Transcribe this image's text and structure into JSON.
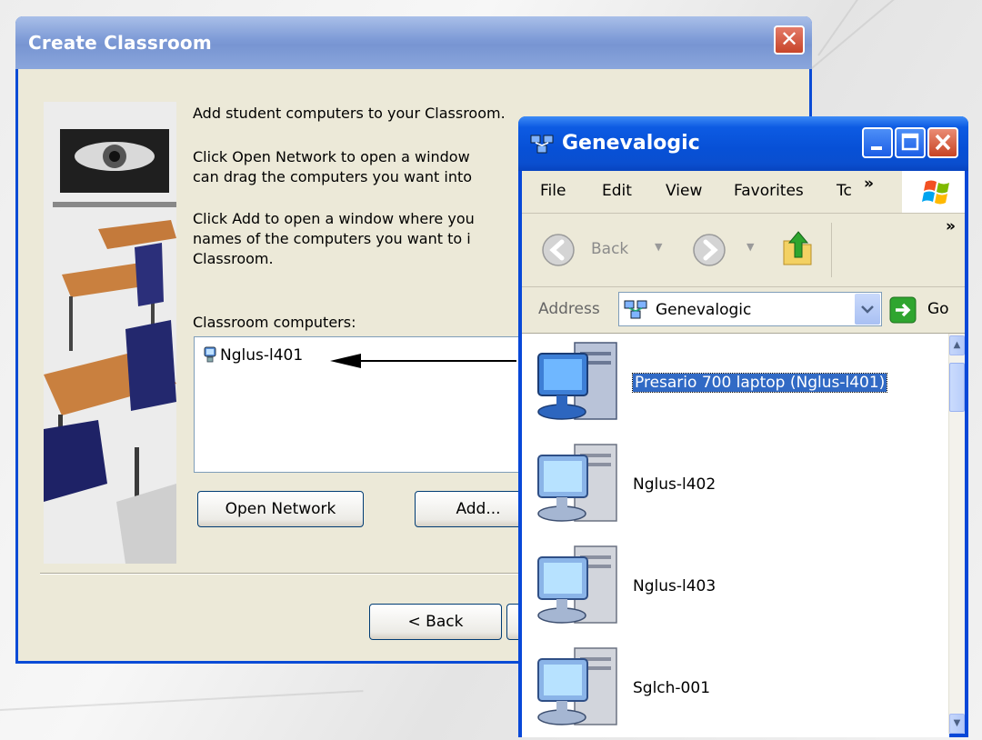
{
  "dialog": {
    "title": "Create Classroom",
    "close_label": "✕",
    "intro": "Add student computers to your Classroom.",
    "open_network_line1": "Click Open Network to open a window",
    "open_network_line2": "can drag the computers you want into",
    "add_line1": "Click Add to open a window where you",
    "add_line2": "names of the computers you want to i",
    "add_line3": "Classroom.",
    "list_label": "Classroom computers:",
    "list_items": [
      "Nglus-l401"
    ],
    "open_network_button": "Open Network",
    "add_button": "Add...",
    "back_button": "< Back"
  },
  "explorer": {
    "title": "Genevalogic",
    "menu": [
      "File",
      "Edit",
      "View",
      "Favorites",
      "Tc"
    ],
    "menu_overflow": "»",
    "toolbar_overflow": "»",
    "back_label": "Back",
    "address_label": "Address",
    "address_value": "Genevalogic",
    "go_label": "Go",
    "computers": [
      {
        "name": "Presario 700 laptop (Nglus-l401)",
        "selected": true
      },
      {
        "name": "Nglus-l402",
        "selected": false
      },
      {
        "name": "Nglus-l403",
        "selected": false
      },
      {
        "name": "Sglch-001",
        "selected": false
      }
    ]
  },
  "colors": {
    "xp_blue": "#0a4fd0",
    "dialog_title_inactive": "#7d9ad6",
    "selection": "#316ac5",
    "close_red": "#c8452a"
  }
}
